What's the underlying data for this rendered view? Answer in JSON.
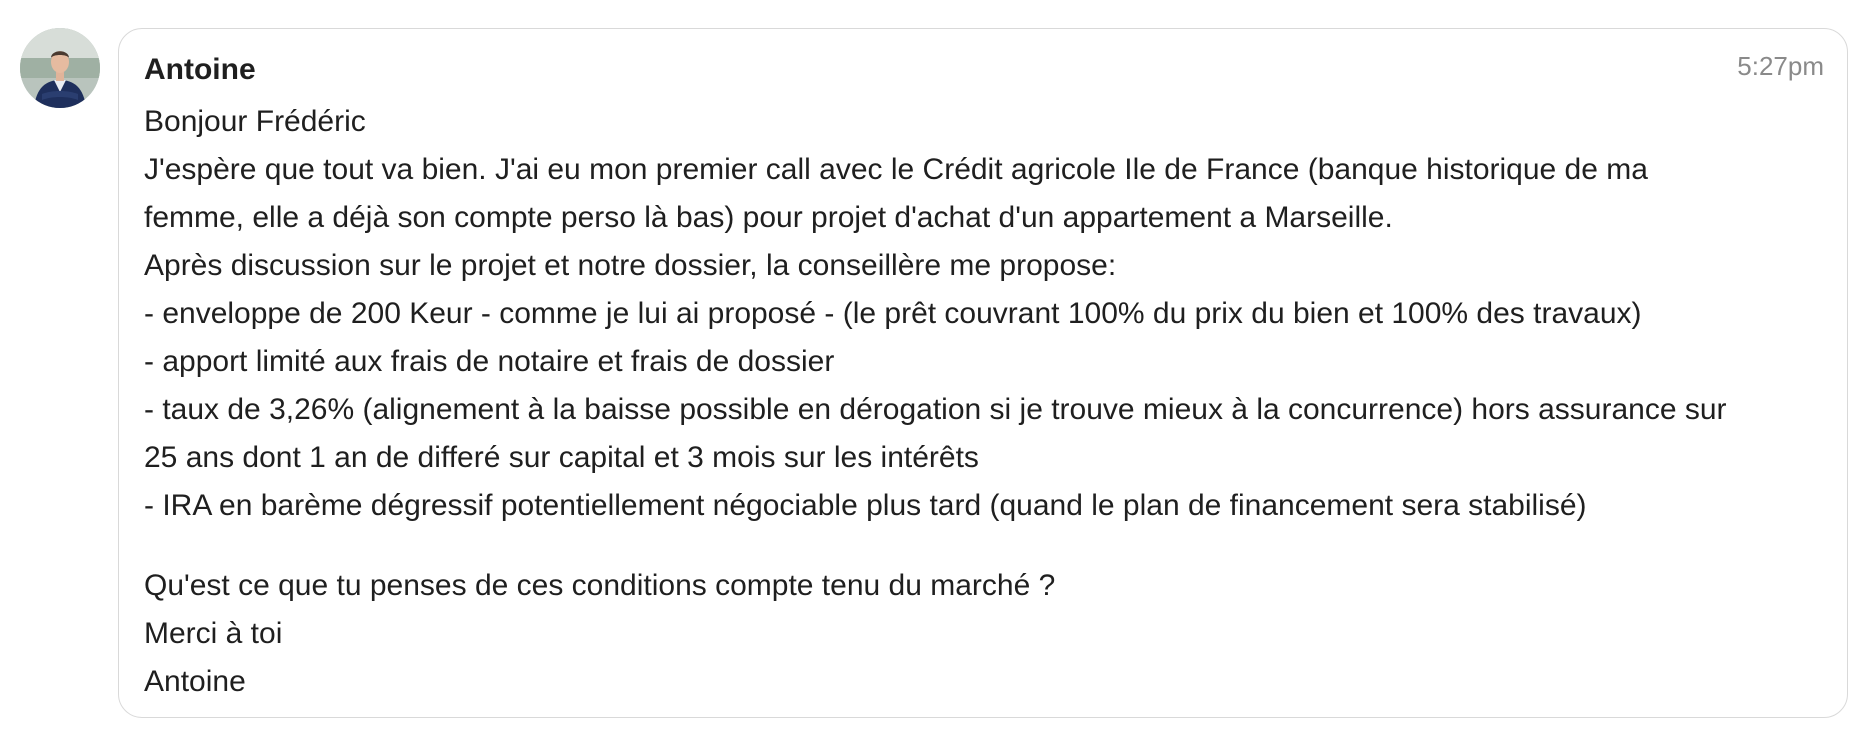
{
  "message": {
    "sender": "Antoine",
    "timestamp": "5:27pm",
    "avatar_icon": "person-avatar-icon",
    "paragraph1": [
      "Bonjour Frédéric",
      "J'espère que tout va bien. J'ai eu mon premier call avec le Crédit agricole Ile de France (banque historique de ma",
      "femme, elle a déjà son compte perso là bas) pour projet d'achat d'un appartement a Marseille.",
      "Après discussion sur le projet et notre dossier, la conseillère me propose:",
      "- enveloppe de 200 Keur - comme je lui ai proposé - (le prêt couvrant 100% du prix du bien et 100% des travaux)",
      "- apport limité aux frais de notaire et frais de dossier",
      "- taux de 3,26% (alignement à la baisse possible en dérogation si je trouve mieux à la concurrence) hors assurance sur",
      "25 ans dont 1 an de differé sur capital et 3 mois sur les intérêts",
      "- IRA en barème dégressif potentiellement négociable plus tard (quand le plan de financement sera stabilisé)"
    ],
    "paragraph2": [
      "Qu'est ce que tu penses de ces conditions compte tenu du marché ?",
      "Merci à toi",
      "Antoine"
    ]
  },
  "colors": {
    "border": "#d9d9d9",
    "text": "#1f1f1f",
    "timestamp": "#8a8a8a",
    "background": "#ffffff"
  }
}
